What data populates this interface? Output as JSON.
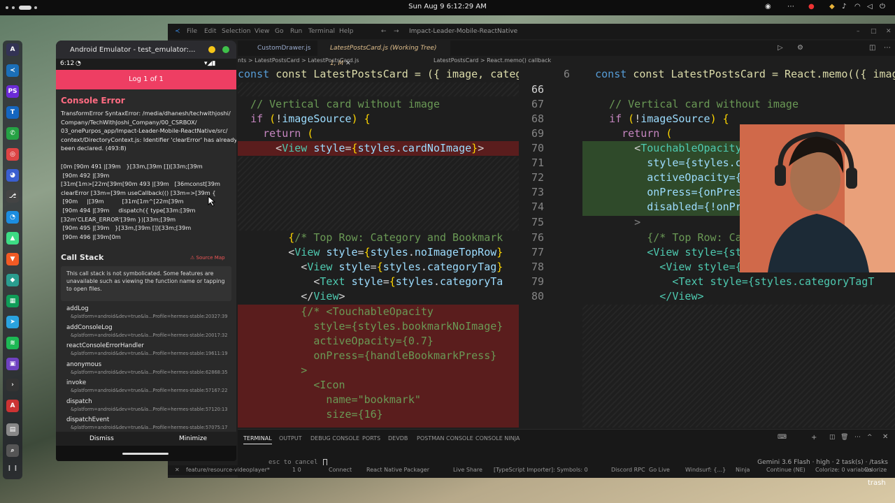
{
  "topbar": {
    "clock": "Sun Aug 9   6:12:29 AM"
  },
  "vscode": {
    "menus": [
      "File",
      "Edit",
      "Selection",
      "View",
      "Go",
      "Run",
      "Terminal",
      "Help"
    ],
    "window_title": "Impact-Leader-Mobile-ReactNative",
    "tabs": [
      {
        "label": "CustomDrawer.js"
      },
      {
        "label": "LatestPostsCard.js (Working Tree)",
        "badge": "1, M"
      }
    ],
    "breadcrumb_left": "nts > LatestPostsCard > LatestPostsCard.js",
    "breadcrumb_right": "LatestPostsCard > React.memo() callback",
    "left_header": "const LatestPostsCard = ({ image, categor",
    "right_header_num": "6",
    "right_header": "const LatestPostsCard = React.memo(({ image",
    "left_lines": [
      "  // Vertical card without image",
      "  if (!imageSource) {",
      "    return (",
      "      <View style={styles.cardNoImage}>",
      "        {/* Top Row: Category and Bookmark",
      "        <View style={styles.noImageTopRow}",
      "          <View style={styles.categoryTag}",
      "            <Text style={styles.categoryTa",
      "          </View>",
      "          {/* <TouchableOpacity",
      "            style={styles.bookmarkNoImage}",
      "            activeOpacity={0.7}",
      "            onPress={handleBookmarkPress}",
      "          >",
      "            <Icon",
      "              name=\"bookmark\"",
      "              size={16}"
    ],
    "right_nums": [
      "66",
      "67",
      "68",
      "69",
      "70",
      "71",
      "72",
      "73",
      "74",
      "75",
      "76",
      "77",
      "78",
      "79",
      "80"
    ],
    "right_lines": [
      "",
      "  // Vertical card without image",
      "  if (!imageSource) {",
      "    return (",
      "      <TouchableOpacity",
      "        style={styles.ca",
      "        activeOpacity={0",
      "        onPress={onPress",
      "        disabled={!onPre",
      "      >",
      "        {/* Top Row: Cat",
      "        <View style={sty",
      "          <View style={styles.categoryTag}>",
      "            <Text style={styles.categoryTagT",
      "          </View>"
    ],
    "panel_tabs": [
      "TERMINAL",
      "OUTPUT",
      "DEBUG CONSOLE",
      "PORTS",
      "DEVDB",
      "POSTMAN CONSOLE",
      "CONSOLE NINJA"
    ],
    "terminal_left": "esc to cancel",
    "terminal_right": "Gemini 3.6 Flash · high · 2 task(s) · /tasks",
    "status_items": [
      "feature/resource-videoplayer*",
      "1 0",
      "Connect",
      "React Native Packager",
      "Live Share",
      "[TypeScript Importer]: Symbols: 0",
      "Discord RPC",
      "Go Live",
      "Windsurf: {...}",
      "Ninja",
      "Continue (NE)",
      "Colorize: 0 variables",
      "Colorize"
    ]
  },
  "emulator": {
    "title": "Android Emulator - test_emulator:...",
    "time": "6:12",
    "log_label": "Log 1 of 1",
    "error_title": "Console Error",
    "error_message": "TransformError SyntaxError: /media/dhanesh/techwithjoshi/\nCompany/TechWithJoshi_Company/00_CSRBOX/\n03_onePurpos_app/Impact-Leader-Mobile-ReactNative/src/\ncontext/DirectoryContext.js: Identifier 'clearError' has already\nbeen declared. (493:8)",
    "code_frame": "[0m [90m 491 |[39m   }[33m,[39m [])[33m;[39m\n [90m 492 |[39m\n[31m[1m>[22m[39m[90m 493 |[39m   [36mconst[39m\nclearError [33m=[39m useCallback(() [33m=>[39m {\n [90m     |[39m          [31m[1m^[22m[39m\n [90m 494 |[39m     dispatch({ type[33m:[39m\n[32m'CLEAR_ERROR'[39m })[33m;[39m\n [90m 495 |[39m   }[33m,[39m [])[33m;[39m\n [90m 496 |[39m[0m",
    "call_stack_title": "Call Stack",
    "source_map": "Source Map",
    "call_stack_note": "This call stack is not symbolicated. Some features are unavailable such as viewing the function name or tapping to open files.",
    "frames": [
      {
        "name": "addLog",
        "src": "&platform=android&dev=true&la...Profile=hermes-stable:20327:39"
      },
      {
        "name": "addConsoleLog",
        "src": "&platform=android&dev=true&la...Profile=hermes-stable:20017:32"
      },
      {
        "name": "reactConsoleErrorHandler",
        "src": "&platform=android&dev=true&la...Profile=hermes-stable:19611:19"
      },
      {
        "name": "anonymous",
        "src": "&platform=android&dev=true&la...Profile=hermes-stable:62868:35"
      },
      {
        "name": "invoke",
        "src": "&platform=android&dev=true&la...Profile=hermes-stable:57167:22"
      },
      {
        "name": "dispatch",
        "src": "&platform=android&dev=true&la...Profile=hermes-stable:57120:13"
      },
      {
        "name": "dispatchEvent",
        "src": "&platform=android&dev=true&la...Profile=hermes-stable:57075:17"
      }
    ],
    "dismiss": "Dismiss",
    "minimize": "Minimize"
  },
  "desktop": {
    "trash_label": "trash"
  }
}
